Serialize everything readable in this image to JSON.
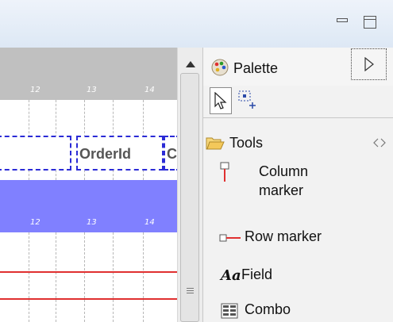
{
  "window": {
    "minimize_icon": "minimize-icon",
    "maximize_icon": "maximize-icon"
  },
  "rulers": {
    "top_ticks": [
      "12",
      "13",
      "14"
    ],
    "bottom_ticks": [
      "12",
      "13",
      "14"
    ]
  },
  "report": {
    "field_label": "OrderId",
    "partial_field_label": "C"
  },
  "palette": {
    "title": "Palette",
    "section": "Tools",
    "items": [
      {
        "label_line1": "Column",
        "label_line2": "marker",
        "icon": "column-marker-icon"
      },
      {
        "label": "Row marker",
        "icon": "row-marker-icon"
      },
      {
        "label": "Field",
        "icon": "field-icon"
      },
      {
        "label": "Combo",
        "icon": "combo-icon"
      }
    ]
  },
  "colors": {
    "ruler_gray": "#c0c0c0",
    "ruler_blue": "#8080ff",
    "field_border": "#2b2bd6",
    "marker_red": "#e03030"
  }
}
